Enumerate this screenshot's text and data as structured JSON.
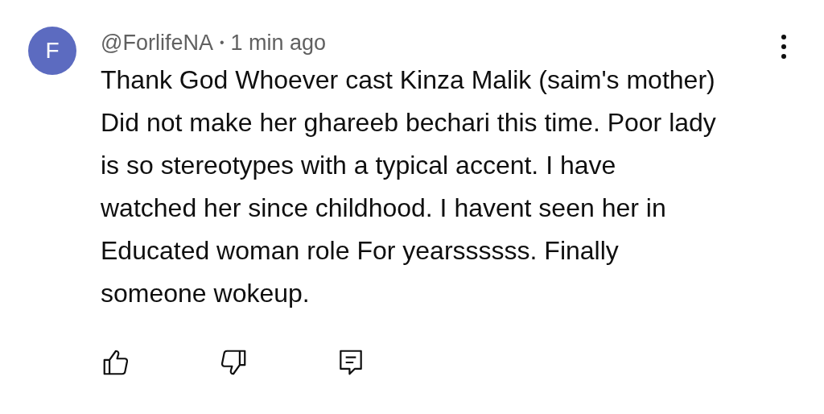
{
  "comment": {
    "avatar_letter": "F",
    "author": "@ForlifeNA",
    "separator": "•",
    "time": "1 min ago",
    "text": "Thank God Whoever cast Kinza Malik (saim's mother) Did not make her ghareeb bechari this time. Poor lady is so stereotypes with a typical accent. I have watched her since childhood. I havent seen her in Educated woman role For yearssssss. Finally someone wokeup."
  }
}
